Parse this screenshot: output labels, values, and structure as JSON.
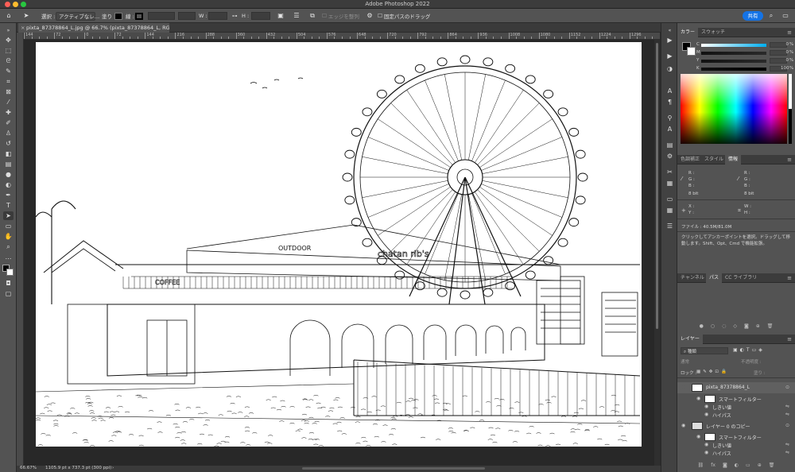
{
  "app": {
    "title": "Adobe Photoshop 2022"
  },
  "options_bar": {
    "select_label": "選択 :",
    "select_value": "アクティブなレ…",
    "fill_label": "塗り :",
    "stroke_label": "線 :",
    "w_label": "W :",
    "h_label": "H :",
    "edge_align": "エッジを整列",
    "fixed_path_drag": "固定パスのドラッグ",
    "share": "共有"
  },
  "document": {
    "tab_title": "pixta_87378864_L.jpg @ 66.7% (pixta_87378864_L, RGB/8) *",
    "ruler_labels": [
      "144",
      "72",
      "0",
      "72",
      "144",
      "216",
      "288",
      "360",
      "432",
      "504",
      "576",
      "648",
      "720",
      "792",
      "864",
      "936",
      "1008",
      "1080",
      "1152",
      "1224",
      "1296"
    ],
    "zoom": "66.67%",
    "doc_size": "1105.9 pt x 737.3 pt (300 ppi)"
  },
  "color_panel": {
    "tabs": [
      "カラー",
      "スウォッチ"
    ],
    "active_tab": "カラー",
    "channels": [
      {
        "label": "C",
        "value": "0",
        "unit": "%"
      },
      {
        "label": "M",
        "value": "0",
        "unit": "%"
      },
      {
        "label": "Y",
        "value": "0",
        "unit": "%"
      },
      {
        "label": "K",
        "value": "100",
        "unit": "%"
      }
    ]
  },
  "info_panel": {
    "tabs": [
      "色調補正",
      "スタイル",
      "情報"
    ],
    "active_tab": "情報",
    "rgb_left": [
      "R :",
      "G :",
      "B :"
    ],
    "rgb_right": [
      "R :",
      "G :",
      "B :"
    ],
    "bits_left": "8 bit",
    "bits_right": "8 bit",
    "xy": [
      "X :",
      "Y :"
    ],
    "wh": [
      "W :",
      "H :"
    ],
    "file": "ファイル : 40.5M/81.0M",
    "hint": "クリックしてアンカーポイントを選択。ドラッグして移動します。Shift、Opt、Cmd で機能拡張。"
  },
  "paths_panel": {
    "tabs": [
      "チャンネル",
      "パス",
      "CC ライブラリ"
    ],
    "active_tab": "パス"
  },
  "layers_panel": {
    "title": "レイヤー",
    "kind_filter": "種類",
    "blend_mode": "通常",
    "opacity_label": "不透明度 :",
    "lock_label": "ロック :",
    "fill_label": "塗り :",
    "layers": [
      {
        "name": "pixta_87378864_L",
        "kind": "layer",
        "visible": false,
        "selected": true
      },
      {
        "name": "スマートフィルター",
        "kind": "filter-group"
      },
      {
        "name": "しきい値",
        "kind": "filter"
      },
      {
        "name": "ハイパス",
        "kind": "filter"
      },
      {
        "name": "レイヤー 0 のコピー",
        "kind": "layer",
        "visible": true
      },
      {
        "name": "スマートフィルター",
        "kind": "filter-group"
      },
      {
        "name": "しきい値",
        "kind": "filter"
      },
      {
        "name": "ハイパス",
        "kind": "filter"
      }
    ]
  },
  "artwork_signs": [
    "OUTDOOR",
    "chatan rib's",
    "COFFEE"
  ],
  "colors": {
    "accent": "#1473e6",
    "panel_bg": "#535353",
    "dark_bg": "#282828"
  }
}
